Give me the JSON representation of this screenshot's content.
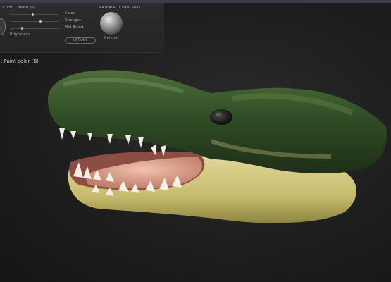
{
  "panel": {
    "title_left": "Color  1  Brush (0)",
    "material_header": "MATERIAL 1 (OUTPUT)",
    "material_label": "Cellular",
    "options_label": "OPTIONS",
    "items_mid": [
      "Color",
      "Stronger",
      "Mid Blend"
    ],
    "brightness_label": "Brightness"
  },
  "status_label": ": Paint color (B)",
  "colors": {
    "panel_bg": "#2a2a2c",
    "viewport_bg": "#222223",
    "skin_dark": "#2f4a26",
    "skin_light": "#c9c27a",
    "tongue": "#d9a38c"
  },
  "icons": [
    "color-swatch-icon",
    "material-ball-icon"
  ]
}
